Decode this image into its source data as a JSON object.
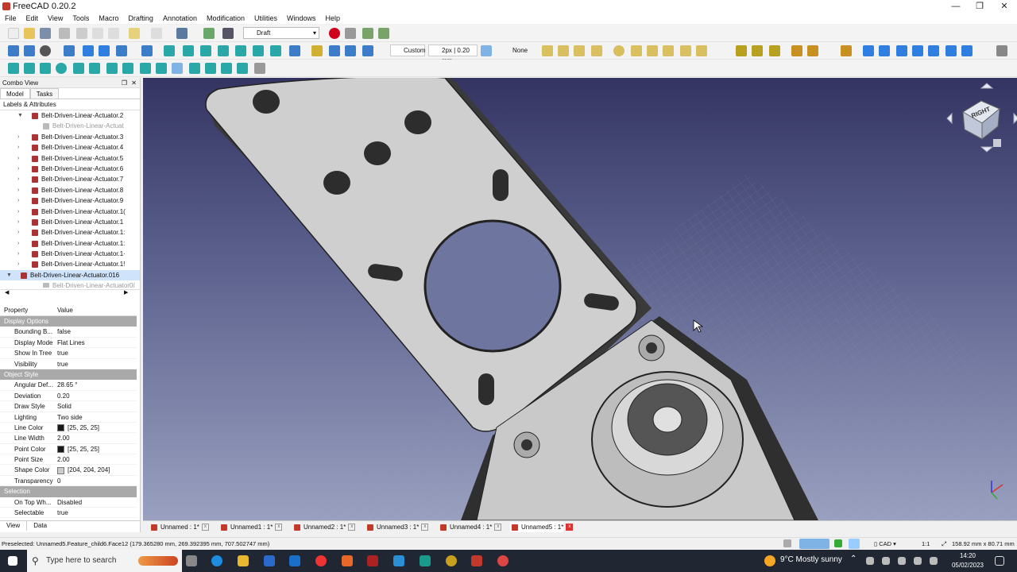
{
  "window": {
    "title": "FreeCAD 0.20.2"
  },
  "menu": [
    "File",
    "Edit",
    "View",
    "Tools",
    "Macro",
    "Drafting",
    "Annotation",
    "Modification",
    "Utilities",
    "Windows",
    "Help"
  ],
  "toolbar": {
    "workbench": "Draft",
    "style_preset": "Custom",
    "line_width": "2px | 0.20 mm",
    "snap_none": "None"
  },
  "combo_view": {
    "title": "Combo View",
    "tabs": [
      "Model",
      "Tasks"
    ],
    "tree_header": "Labels & Attributes",
    "tree_items": [
      {
        "label": "Belt-Driven-Linear-Actuator.2",
        "level": 1,
        "expanded": true
      },
      {
        "label": "Belt-Driven-Linear-Actuat",
        "level": 2,
        "dim": true
      },
      {
        "label": "Belt-Driven-Linear-Actuator.3",
        "level": 1
      },
      {
        "label": "Belt-Driven-Linear-Actuator.4",
        "level": 1
      },
      {
        "label": "Belt-Driven-Linear-Actuator.5",
        "level": 1
      },
      {
        "label": "Belt-Driven-Linear-Actuator.6",
        "level": 1
      },
      {
        "label": "Belt-Driven-Linear-Actuator.7",
        "level": 1
      },
      {
        "label": "Belt-Driven-Linear-Actuator.8",
        "level": 1
      },
      {
        "label": "Belt-Driven-Linear-Actuator.9",
        "level": 1
      },
      {
        "label": "Belt-Driven-Linear-Actuator.1(",
        "level": 1
      },
      {
        "label": "Belt-Driven-Linear-Actuator.1",
        "level": 1
      },
      {
        "label": "Belt-Driven-Linear-Actuator.1:",
        "level": 1
      },
      {
        "label": "Belt-Driven-Linear-Actuator.1:",
        "level": 1
      },
      {
        "label": "Belt-Driven-Linear-Actuator.1·",
        "level": 1
      },
      {
        "label": "Belt-Driven-Linear-Actuator.1!",
        "level": 1
      },
      {
        "label": "Belt-Driven-Linear-Actuator.016",
        "level": 0,
        "expanded": true,
        "selected": true
      },
      {
        "label": "Belt-Driven-Linear-Actuator0(",
        "level": 2,
        "dim": true
      }
    ],
    "props_header": {
      "property": "Property",
      "value": "Value"
    },
    "groups": [
      {
        "name": "Display Options",
        "rows": [
          {
            "k": "Bounding B...",
            "v": "false"
          },
          {
            "k": "Display Mode",
            "v": "Flat Lines"
          },
          {
            "k": "Show In Tree",
            "v": "true"
          },
          {
            "k": "Visibility",
            "v": "true"
          }
        ]
      },
      {
        "name": "Object Style",
        "rows": [
          {
            "k": "Angular Def...",
            "v": "28.65 °"
          },
          {
            "k": "Deviation",
            "v": "0.20"
          },
          {
            "k": "Draw Style",
            "v": "Solid"
          },
          {
            "k": "Lighting",
            "v": "Two side"
          },
          {
            "k": "Line Color",
            "v": "[25, 25, 25]",
            "swatch": "#191919"
          },
          {
            "k": "Line Width",
            "v": "2.00"
          },
          {
            "k": "Point Color",
            "v": "[25, 25, 25]",
            "swatch": "#191919"
          },
          {
            "k": "Point Size",
            "v": "2.00"
          },
          {
            "k": "Shape Color",
            "v": "[204, 204, 204]",
            "swatch": "#cccccc"
          },
          {
            "k": "Transparency",
            "v": "0"
          }
        ]
      },
      {
        "name": "Selection",
        "rows": [
          {
            "k": "On Top Wh...",
            "v": "Disabled"
          },
          {
            "k": "Selectable",
            "v": "true"
          }
        ]
      }
    ],
    "bottom_tabs": [
      "View",
      "Data"
    ]
  },
  "navcube": {
    "face": "RIGHT"
  },
  "doc_tabs": [
    "Unnamed : 1*",
    "Unnamed1 : 1*",
    "Unnamed2 : 1*",
    "Unnamed3 : 1*",
    "Unnamed4 : 1*",
    "Unnamed5 : 1*"
  ],
  "status": {
    "preselected": "Preselected: Unnamed5.Feature_child6.Face12 (179.365280 mm, 269.392395 mm, 707.502747 mm)",
    "nav_style": "CAD",
    "scale": "1:1",
    "dimensions": "158.92 mm x 80.71 mm"
  },
  "taskbar": {
    "search_placeholder": "Type here to search",
    "weather": "9°C  Mostly sunny",
    "time": "14:20",
    "date": "05/02/2023"
  },
  "colors": {
    "viewport_top": "#343463",
    "viewport_bottom": "#9aa0bf",
    "part_gray": "#cccccc",
    "selection_blue": "#cfe3fa",
    "group_header": "#a9a9a9"
  }
}
